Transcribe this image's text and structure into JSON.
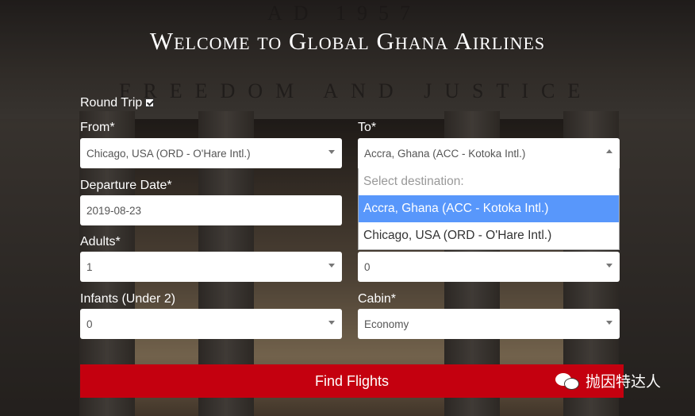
{
  "page": {
    "background_engraving_top": "AD 1957",
    "background_engraving_mid": "FREEDOM AND JUSTICE",
    "title": "Welcome to Global Ghana Airlines"
  },
  "form": {
    "round_trip_label": "Round Trip",
    "round_trip_checked": true,
    "from_label": "From*",
    "from_value": "Chicago, USA (ORD - O'Hare Intl.)",
    "to_label": "To*",
    "to_value": "Accra, Ghana (ACC - Kotoka Intl.)",
    "departure_label": "Departure Date*",
    "departure_value": "2019-08-23",
    "adults_label": "Adults*",
    "adults_value": "1",
    "children_value": "0",
    "infants_label": "Infants (Under 2)",
    "infants_value": "0",
    "cabin_label": "Cabin*",
    "cabin_value": "Economy",
    "find_button": "Find Flights"
  },
  "to_dropdown": {
    "header": "Select destination:",
    "options": [
      "Accra, Ghana (ACC - Kotoka Intl.)",
      "Chicago, USA (ORD - O'Hare Intl.)"
    ],
    "highlighted_index": 0
  },
  "watermark": {
    "text": "抛因特达人"
  },
  "colors": {
    "primary": "#c4000f",
    "highlight": "#5897fb"
  }
}
